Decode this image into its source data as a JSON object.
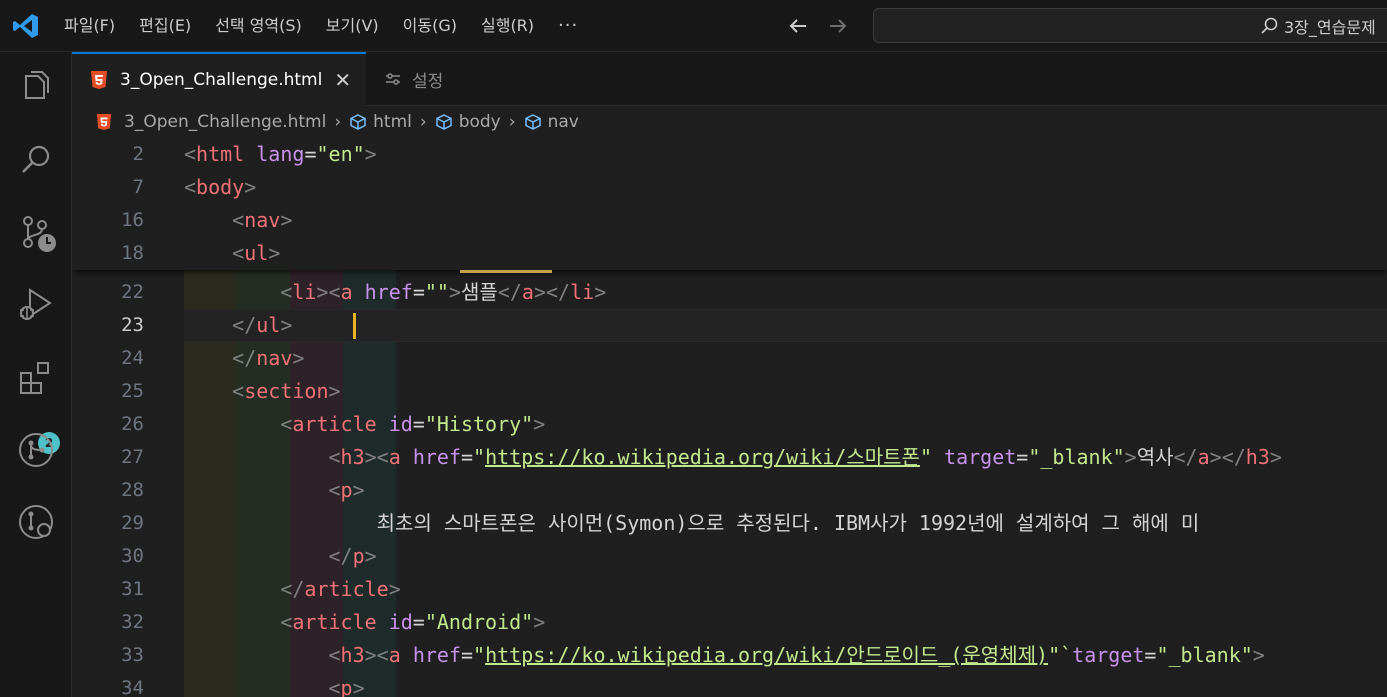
{
  "menu": {
    "items": [
      "파일(F)",
      "편집(E)",
      "선택 영역(S)",
      "보기(V)",
      "이동(G)",
      "실행(R)"
    ],
    "more": "···"
  },
  "search": {
    "text": "3장_연습문제"
  },
  "activity_bar": {
    "icons": [
      "explorer-icon",
      "search-icon",
      "source-control-icon",
      "run-debug-icon",
      "extensions-icon",
      "git-graph-icon",
      "remote-icon"
    ],
    "extensions_badge": "2"
  },
  "tabs": {
    "active_label": "3_Open_Challenge.html",
    "close": "✕",
    "inactive_label": "설정"
  },
  "breadcrumb": {
    "file": "3_Open_Challenge.html",
    "html": "html",
    "body": "body",
    "nav": "nav"
  },
  "editor": {
    "current_line": "23",
    "sticky": [
      {
        "n": "2",
        "pre": "",
        "tag": "html",
        "attr": "lang",
        "val": "\"en\""
      },
      {
        "n": "7",
        "pre": "",
        "tag": "body"
      },
      {
        "n": "16",
        "pre": "    ",
        "tag": "nav"
      },
      {
        "n": "18",
        "pre": "    ",
        "tag": "ul"
      }
    ],
    "lines": [
      {
        "n": "22",
        "parts": [
          [
            "tb",
            "        <"
          ],
          [
            "tg",
            "li"
          ],
          [
            "tb",
            "><"
          ],
          [
            "tg",
            "a "
          ],
          [
            "at",
            "href"
          ],
          [
            "tx",
            "="
          ],
          [
            "st",
            "\"\""
          ],
          [
            "tb",
            ">"
          ],
          [
            "tx",
            "샘플"
          ],
          [
            "tb",
            "</"
          ],
          [
            "tg",
            "a"
          ],
          [
            "tb",
            "></"
          ],
          [
            "tg",
            "li"
          ],
          [
            "tb",
            ">"
          ]
        ]
      },
      {
        "n": "23",
        "parts": [
          [
            "tb",
            "    </"
          ],
          [
            "tg",
            "ul"
          ],
          [
            "tb",
            ">"
          ]
        ]
      },
      {
        "n": "24",
        "parts": [
          [
            "tb",
            "    </"
          ],
          [
            "tg",
            "nav"
          ],
          [
            "tb",
            ">"
          ]
        ]
      },
      {
        "n": "25",
        "parts": [
          [
            "tb",
            "    <"
          ],
          [
            "tg",
            "section"
          ],
          [
            "tb",
            ">"
          ]
        ]
      },
      {
        "n": "26",
        "parts": [
          [
            "tb",
            "        <"
          ],
          [
            "tg",
            "article "
          ],
          [
            "at",
            "id"
          ],
          [
            "tx",
            "="
          ],
          [
            "st",
            "\"History\""
          ],
          [
            "tb",
            ">"
          ]
        ]
      },
      {
        "n": "27",
        "parts": [
          [
            "tb",
            "            <"
          ],
          [
            "tg",
            "h3"
          ],
          [
            "tb",
            "><"
          ],
          [
            "tg",
            "a "
          ],
          [
            "at",
            "href"
          ],
          [
            "tx",
            "="
          ],
          [
            "st",
            "\""
          ],
          [
            "lk",
            "https://ko.wikipedia.org/wiki/스마트폰"
          ],
          [
            "st",
            "\" "
          ],
          [
            "at",
            "target"
          ],
          [
            "tx",
            "="
          ],
          [
            "st",
            "\"_blank\""
          ],
          [
            "tb",
            ">"
          ],
          [
            "tx",
            "역사"
          ],
          [
            "tb",
            "</"
          ],
          [
            "tg",
            "a"
          ],
          [
            "tb",
            "></"
          ],
          [
            "tg",
            "h3"
          ],
          [
            "tb",
            ">"
          ]
        ]
      },
      {
        "n": "28",
        "parts": [
          [
            "tb",
            "            <"
          ],
          [
            "tg",
            "p"
          ],
          [
            "tb",
            ">"
          ]
        ]
      },
      {
        "n": "29",
        "parts": [
          [
            "tx",
            "                최초의 스마트폰은 사이먼(Symon)으로 추정된다. IBM사가 1992년에 설계하여 그 해에 미"
          ]
        ]
      },
      {
        "n": "30",
        "parts": [
          [
            "tb",
            "            </"
          ],
          [
            "tg",
            "p"
          ],
          [
            "tb",
            ">"
          ]
        ]
      },
      {
        "n": "31",
        "parts": [
          [
            "tb",
            "        </"
          ],
          [
            "tg",
            "article"
          ],
          [
            "tb",
            ">"
          ]
        ]
      },
      {
        "n": "32",
        "parts": [
          [
            "tb",
            "        <"
          ],
          [
            "tg",
            "article "
          ],
          [
            "at",
            "id"
          ],
          [
            "tx",
            "="
          ],
          [
            "st",
            "\"Android\""
          ],
          [
            "tb",
            ">"
          ]
        ]
      },
      {
        "n": "33",
        "parts": [
          [
            "tb",
            "            <"
          ],
          [
            "tg",
            "h3"
          ],
          [
            "tb",
            "><"
          ],
          [
            "tg",
            "a "
          ],
          [
            "at",
            "href"
          ],
          [
            "tx",
            "="
          ],
          [
            "st",
            "\""
          ],
          [
            "lk",
            "https://ko.wikipedia.org/wiki/안드로이드_(운영체제)"
          ],
          [
            "st",
            "\"`"
          ],
          [
            "at",
            "target"
          ],
          [
            "tx",
            "="
          ],
          [
            "st",
            "\"_blank\""
          ],
          [
            "tb",
            ">"
          ]
        ]
      },
      {
        "n": "34",
        "parts": [
          [
            "tb",
            "            <"
          ],
          [
            "tg",
            "p"
          ],
          [
            "tb",
            ">"
          ]
        ]
      }
    ]
  },
  "colors": {
    "accent": "#0078d4",
    "tag": "#f07178",
    "attribute": "#c792ea",
    "string": "#c3e88d",
    "cursor": "#e8b322",
    "badge": "#4fc1c9"
  }
}
